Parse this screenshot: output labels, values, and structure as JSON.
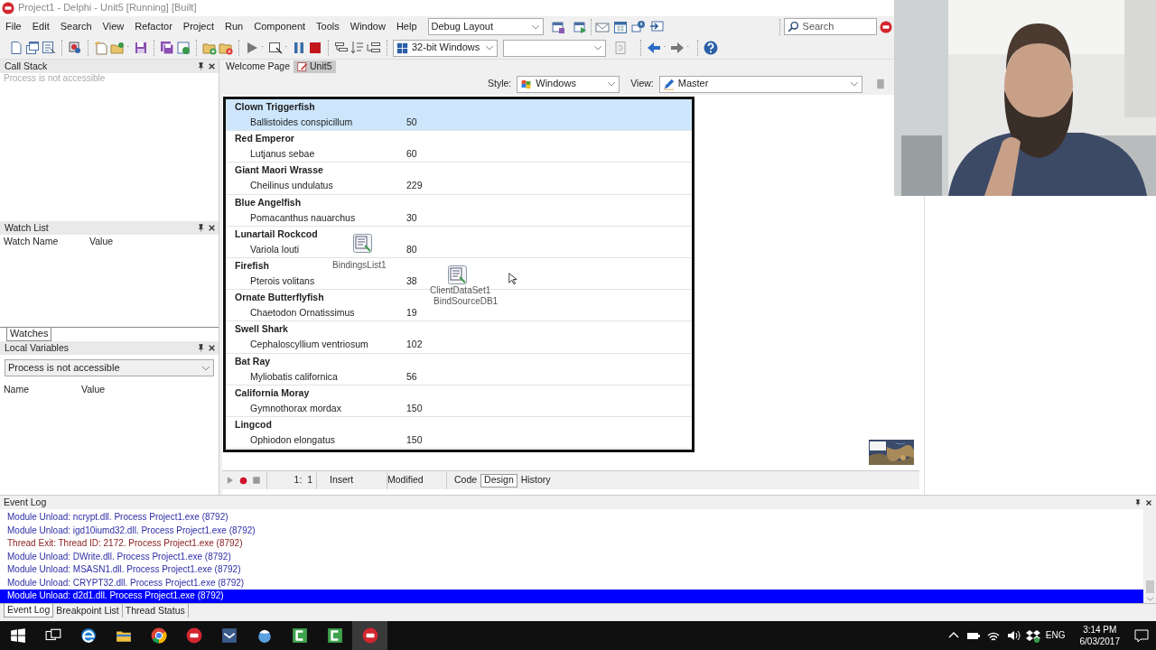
{
  "window": {
    "title": "Project1 - Delphi - Unit5 [Running] [Built]"
  },
  "menu": [
    "File",
    "Edit",
    "Search",
    "View",
    "Refactor",
    "Project",
    "Run",
    "Component",
    "Tools",
    "Window",
    "Help"
  ],
  "layout_combo": {
    "value": "Debug Layout"
  },
  "search": {
    "placeholder": "Search"
  },
  "platform_combo": {
    "value": "32-bit Windows"
  },
  "call_stack": {
    "title": "Call Stack",
    "message": "Process is not accessible"
  },
  "watch_list": {
    "title": "Watch List",
    "columns": [
      "Watch Name",
      "Value"
    ],
    "tabs": [
      {
        "label": "Watches",
        "selected": true
      }
    ]
  },
  "local_variables": {
    "title": "Local Variables",
    "combo": "Process is not accessible",
    "columns": [
      "Name",
      "Value"
    ]
  },
  "editor_tabs": [
    {
      "label": "Welcome Page",
      "selected": false
    },
    {
      "label": "Unit5",
      "selected": true
    }
  ],
  "designer": {
    "style_label": "Style:",
    "style_value": "Windows",
    "view_label": "View:",
    "view_value": "Master"
  },
  "fish_list": [
    {
      "name": "Clown Triggerfish",
      "species": "Ballistoides conspicillum",
      "count": "50",
      "selected": true
    },
    {
      "name": "Red Emperor",
      "species": "Lutjanus sebae",
      "count": "60",
      "selected": false
    },
    {
      "name": "Giant Maori Wrasse",
      "species": "Cheilinus undulatus",
      "count": "229",
      "selected": false
    },
    {
      "name": "Blue Angelfish",
      "species": "Pomacanthus nauarchus",
      "count": "30",
      "selected": false
    },
    {
      "name": "Lunartail Rockcod",
      "species": "Variola louti",
      "count": "80",
      "selected": false
    },
    {
      "name": "Firefish",
      "species": "Pterois volitans",
      "count": "38",
      "selected": false
    },
    {
      "name": "Ornate Butterflyfish",
      "species": "Chaetodon Ornatissimus",
      "count": "19",
      "selected": false
    },
    {
      "name": "Swell Shark",
      "species": "Cephaloscyllium ventriosum",
      "count": "102",
      "selected": false
    },
    {
      "name": "Bat Ray",
      "species": "Myliobatis californica",
      "count": "56",
      "selected": false
    },
    {
      "name": "California Moray",
      "species": "Gymnothorax mordax",
      "count": "150",
      "selected": false
    },
    {
      "name": "Lingcod",
      "species": "Ophiodon elongatus",
      "count": "150",
      "selected": false
    }
  ],
  "components": [
    {
      "label": "BindingsList1"
    },
    {
      "label": "ClientDataSet1"
    },
    {
      "label": "BindSourceDB1"
    }
  ],
  "status": {
    "position": "1:  1",
    "mode": "Insert",
    "state": "Modified"
  },
  "view_tabs": [
    {
      "label": "Code",
      "selected": false
    },
    {
      "label": "Design",
      "selected": true
    },
    {
      "label": "History",
      "selected": false
    }
  ],
  "event_log": {
    "title": "Event Log",
    "entries": [
      {
        "text": "Module Unload: ncrypt.dll. Process Project1.exe (8792)",
        "kind": "module",
        "selected": false
      },
      {
        "text": "Module Unload: igd10iumd32.dll. Process Project1.exe (8792)",
        "kind": "module",
        "selected": false
      },
      {
        "text": "Thread Exit: Thread ID: 2172. Process Project1.exe (8792)",
        "kind": "thread",
        "selected": false
      },
      {
        "text": "Module Unload: DWrite.dll. Process Project1.exe (8792)",
        "kind": "module",
        "selected": false
      },
      {
        "text": "Module Unload: MSASN1.dll. Process Project1.exe (8792)",
        "kind": "module",
        "selected": false
      },
      {
        "text": "Module Unload: CRYPT32.dll. Process Project1.exe (8792)",
        "kind": "module",
        "selected": false
      },
      {
        "text": "Module Unload: d2d1.dll. Process Project1.exe (8792)",
        "kind": "module",
        "selected": true
      }
    ]
  },
  "bottom_tabs": [
    {
      "label": "Event Log",
      "selected": true
    },
    {
      "label": "Breakpoint List",
      "selected": false
    },
    {
      "label": "Thread Status",
      "selected": false
    }
  ],
  "taskbar": {
    "language": "ENG",
    "time": "3:14 PM",
    "date": "6/03/2017"
  }
}
